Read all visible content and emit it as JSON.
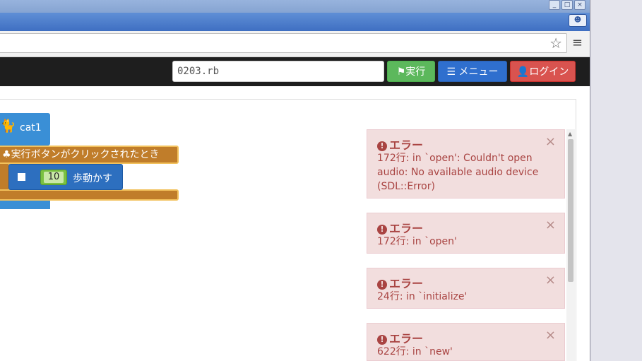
{
  "window": {
    "controls": [
      "_",
      "□",
      "×"
    ],
    "user_icon": "user-icon"
  },
  "toolbar": {
    "star_icon": "star-icon",
    "menu_icon": "menu-icon"
  },
  "navbar": {
    "filename": "0203.rb",
    "run_label": "実行",
    "menu_label": "メニュー",
    "login_label": "ログイン"
  },
  "workspace": {
    "sprite_name": "cat1",
    "hat_block": "実行ボタンがクリックされたとき",
    "move_value": "10",
    "move_label": "歩動かす"
  },
  "errors": [
    {
      "title": "エラー",
      "message": "172行: in `open': Couldn't open audio: No available audio device (SDL::Error)"
    },
    {
      "title": "エラー",
      "message": "172行: in `open'"
    },
    {
      "title": "エラー",
      "message": "24行: in `initialize'"
    },
    {
      "title": "エラー",
      "message": "622行: in `new'"
    }
  ],
  "colors": {
    "run": "#5cb85c",
    "menu": "#2f6fce",
    "login": "#d9534f",
    "error_bg": "#f2dede",
    "error_text": "#a94442"
  }
}
